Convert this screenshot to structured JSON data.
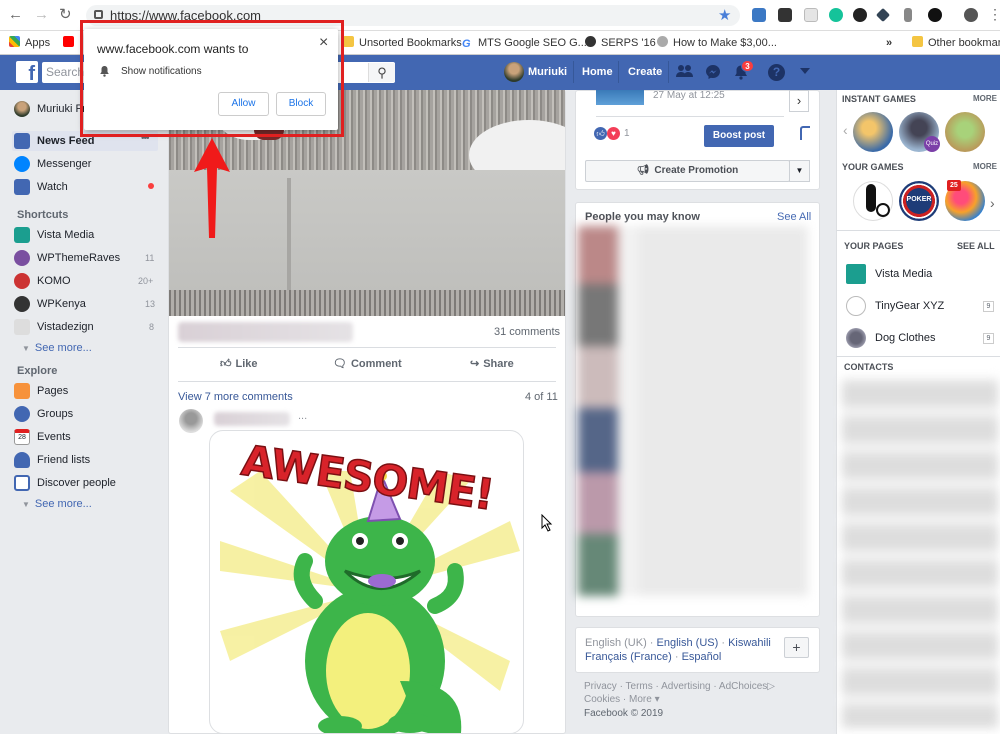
{
  "browser": {
    "url": "https://www.facebook.com",
    "bookmarks": [
      "Apps",
      "Unsorted Bookmarks",
      "MTS Google SEO G...",
      "SERPS '16",
      "How to Make $3,00...",
      "Other bookmarks"
    ],
    "more": "»"
  },
  "header": {
    "search_placeholder": "Search",
    "user": "Muriuki",
    "home": "Home",
    "create": "Create",
    "notif_count": "3"
  },
  "popup": {
    "title": "www.facebook.com wants to",
    "message": "Show notifications",
    "allow": "Allow",
    "block": "Block",
    "close": "×"
  },
  "left_nav": {
    "profile": "Muriuki Fr",
    "items": [
      {
        "label": "News Feed"
      },
      {
        "label": "Messenger"
      },
      {
        "label": "Watch"
      }
    ],
    "more_dots": "•••",
    "shortcuts_title": "Shortcuts",
    "shortcuts": [
      {
        "label": "Vista Media",
        "count": ""
      },
      {
        "label": "WPThemeRaves",
        "count": "11"
      },
      {
        "label": "KOMO",
        "count": "20+"
      },
      {
        "label": "WPKenya",
        "count": "13"
      },
      {
        "label": "Vistadezign",
        "count": "8"
      }
    ],
    "see_more": "See more...",
    "explore_title": "Explore",
    "explore": [
      {
        "label": "Pages"
      },
      {
        "label": "Groups"
      },
      {
        "label": "Events"
      },
      {
        "label": "Friend lists"
      },
      {
        "label": "Discover people"
      }
    ],
    "see_more2": "See more...",
    "events_day": "28"
  },
  "post": {
    "comments_count": "31 comments",
    "like": "Like",
    "comment": "Comment",
    "share": "Share",
    "view_more": "View 7 more comments",
    "pager": "4 of 11",
    "ellipsis": "...",
    "sticker_text": "AWESOME!"
  },
  "promo": {
    "date": "27 May at 12:25",
    "reactions": "1",
    "boost": "Boost post",
    "create_promotion": "Create Promotion"
  },
  "pymk": {
    "title": "People you may know",
    "see_all": "See All"
  },
  "languages": {
    "line1": [
      "English (UK)",
      "English (US)",
      "Kiswahili"
    ],
    "line2": [
      "Français (France)",
      "Español"
    ],
    "sep": " · ",
    "add": "+"
  },
  "footer": {
    "line1": [
      "Privacy",
      "Terms",
      "Advertising",
      "AdChoices"
    ],
    "line2": [
      "Cookies",
      "More"
    ],
    "sep": " · ",
    "more_suffix": " ▾",
    "adchoices_icon": "▷",
    "copy": "Facebook © 2019"
  },
  "right": {
    "instant_games": "INSTANT GAMES",
    "more": "MORE",
    "your_games": "YOUR GAMES",
    "your_pages": "YOUR PAGES",
    "see_all": "SEE ALL",
    "pages": [
      {
        "label": "Vista Media",
        "count": ""
      },
      {
        "label": "TinyGear XYZ",
        "count": "9"
      },
      {
        "label": "Dog Clothes",
        "count": "9"
      }
    ],
    "contacts": "CONTACTS",
    "game_badge": "25",
    "game_poker": "POKER",
    "game_quiz": "Quiz"
  }
}
